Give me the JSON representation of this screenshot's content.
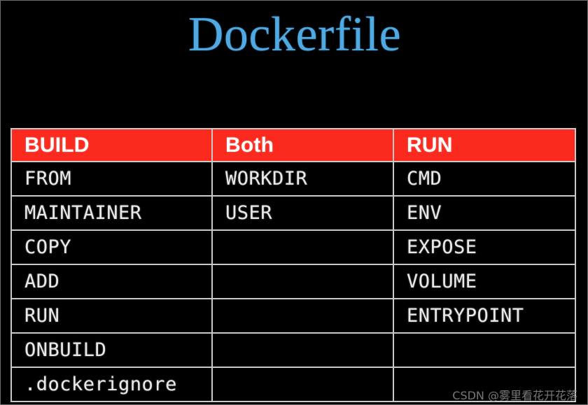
{
  "slide": {
    "title": "Dockerfile",
    "background_color": "#000000",
    "title_color": "#4fa9e2",
    "header_color": "#fa2a1e",
    "border_color": "#c9c9c9",
    "text_color": "#e9e9e9"
  },
  "table": {
    "headers": [
      "BUILD",
      "Both",
      "RUN"
    ],
    "rows": [
      [
        "FROM",
        "WORKDIR",
        "CMD"
      ],
      [
        "MAINTAINER",
        "USER",
        "ENV"
      ],
      [
        "COPY",
        "",
        "EXPOSE"
      ],
      [
        "ADD",
        "",
        "VOLUME"
      ],
      [
        "RUN",
        "",
        "ENTRYPOINT"
      ],
      [
        "ONBUILD",
        "",
        ""
      ],
      [
        ".dockerignore",
        "",
        ""
      ]
    ]
  },
  "watermark": {
    "text": "CSDN @雾里看花开花落",
    "color": "#8d8d8d"
  }
}
